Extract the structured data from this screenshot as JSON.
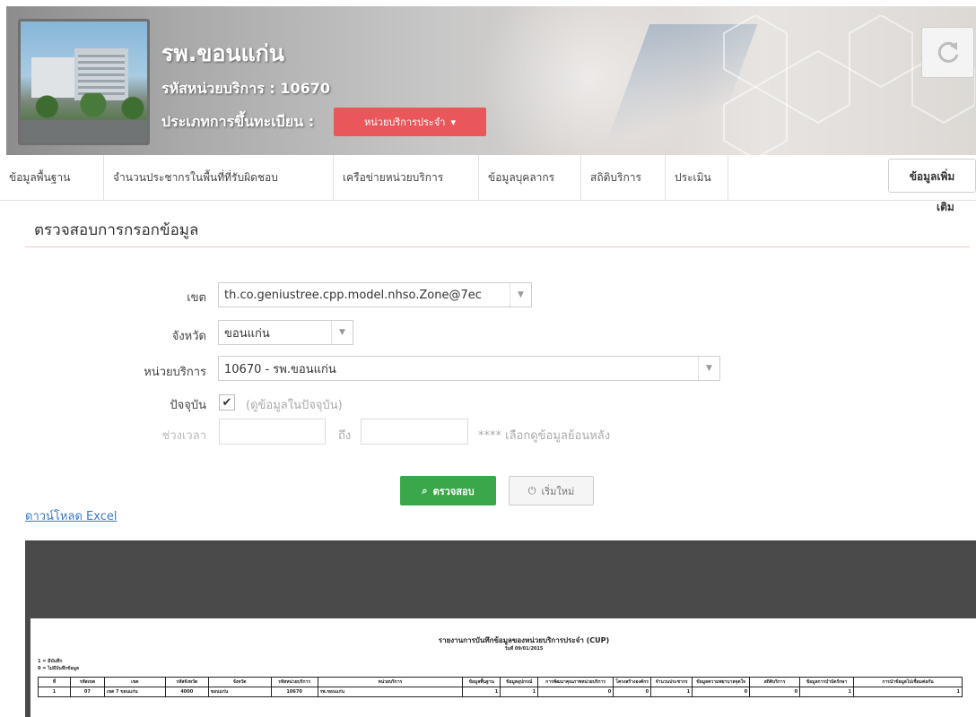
{
  "header": {
    "hospital_name": "รพ.ขอนแก่น",
    "service_code_label": "รหัสหน่วยบริการ : 10670",
    "registration_type_label": "ประเภทการขึ้นทะเบียน :",
    "registration_type_value": "หน่วยบริการประจำ",
    "accent_color": "#e9575a"
  },
  "nav": {
    "items": [
      {
        "label": "ข้อมูลพื้นฐาน"
      },
      {
        "label": "จำนวนประชากรในพื้นที่ที่รับผิดชอบ"
      },
      {
        "label": "เครือข่ายหน่วยบริการ"
      },
      {
        "label": "ข้อมูลบุคลากร"
      },
      {
        "label": "สถิติบริการ"
      },
      {
        "label": "ประเมิน"
      }
    ],
    "more_label_line1": "ข้อมูลเพิ่ม",
    "more_label_line2": "เติม"
  },
  "section": {
    "title": "ตรวจสอบการกรอกข้อมูล"
  },
  "form": {
    "zone_label": "เขต",
    "zone_value": "th.co.geniustree.cpp.model.nhso.Zone@7ec",
    "province_label": "จังหวัด",
    "province_value": "ขอนแก่น",
    "unit_label": "หน่วยบริการ",
    "unit_value": "10670 - รพ.ขอนแก่น",
    "current_label": "ปัจจุบัน",
    "current_hint": "(ดูข้อมูลในปัจจุบัน)",
    "period_label": "ช่วงเวลา",
    "to_label": "ถึง",
    "period_hint": "**** เลือกดูข้อมูลย้อนหลัง",
    "check_button": "ตรวจสอบ",
    "reset_button": "เริ่มใหม่",
    "check_color": "#3aa84a"
  },
  "download_link": "ดาวน์โหลด Excel",
  "report": {
    "title": "รายงานการบันทึกข้อมูลของหน่วยบริการประจำ (CUP)",
    "date": "วันที่ 09/01/2015",
    "note1": "1 = มีบันทึก",
    "note2": "0 = ไม่มีบันทึกข้อมูล",
    "columns": [
      "ที่",
      "รหัสเขต",
      "เขต",
      "รหัสจังหวัด",
      "จังหวัด",
      "รหัสหน่วยบริการ",
      "หน่วยบริการ",
      "ข้อมูลพื้นฐาน",
      "ข้อมูลอุปกรณ์",
      "การพัฒนาคุณภาพหน่วยบริการ",
      "โครงสร้างองค์กร",
      "จำนวนประชากร",
      "ข้อมูลความพยาบาลจุดใจ",
      "สถิติบริการ",
      "ข้อมูลการบำบัดรักษา",
      "การนำข้อมูลไปเชื่อมต่อกัน"
    ],
    "rows": [
      [
        "1",
        "07",
        "เขต 7 ขอนแก่น",
        "4000",
        "ขอนแก่น",
        "10670",
        "รพ.ขอนแก่น",
        "1",
        "1",
        "0",
        "0",
        "1",
        "0",
        "0",
        "1",
        "1"
      ]
    ]
  }
}
